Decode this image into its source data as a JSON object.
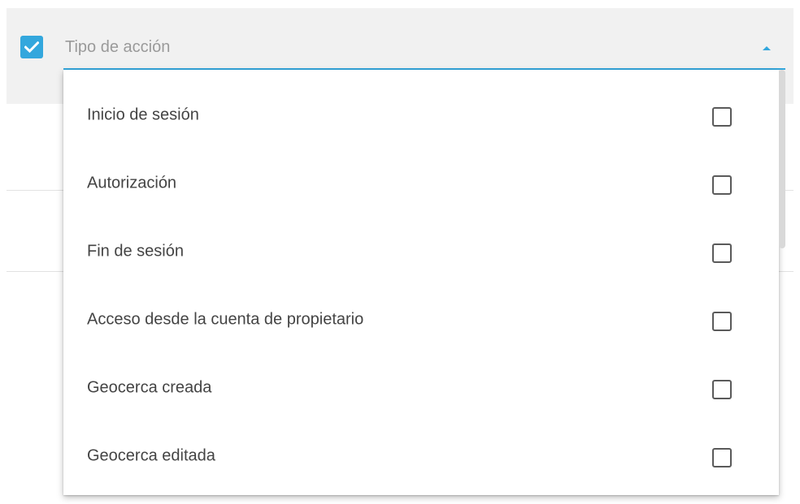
{
  "colors": {
    "accent": "#33a7dd",
    "header_background": "#f1f1f1",
    "option_text": "#444444",
    "field_label_text": "#9a9a9a"
  },
  "filter": {
    "checked": true,
    "label": "Tipo de acción",
    "icons": {
      "checkbox": "check-icon",
      "toggle": "caret-up-icon"
    }
  },
  "dropdown": {
    "options": [
      {
        "label": "Inicio de sesión",
        "checked": false
      },
      {
        "label": "Autorización",
        "checked": false
      },
      {
        "label": "Fin de sesión",
        "checked": false
      },
      {
        "label": "Acceso desde la cuenta de propietario",
        "checked": false
      },
      {
        "label": "Geocerca creada",
        "checked": false
      },
      {
        "label": "Geocerca editada",
        "checked": false
      }
    ]
  }
}
